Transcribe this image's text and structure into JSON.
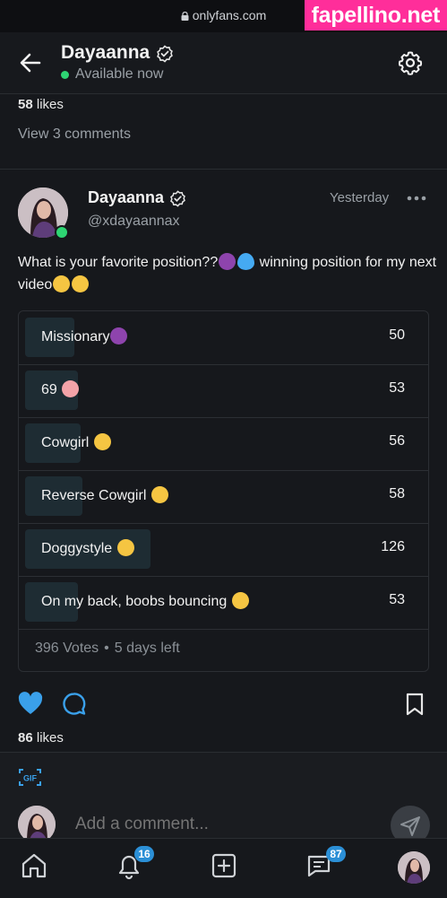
{
  "status_bar": {
    "url": "onlyfans.com",
    "watermark": "fapellino.net"
  },
  "header": {
    "name": "Dayaanna",
    "status": "Available now"
  },
  "previous_post": {
    "likes_count": "58",
    "likes_word": "likes",
    "comments_link": "View 3 comments"
  },
  "post": {
    "author_name": "Dayaanna",
    "handle": "@xdayaannax",
    "time": "Yesterday",
    "text_part1": "What is your favorite position??",
    "text_part2": " winning position for my next video",
    "poll": {
      "options": [
        {
          "label": "Missionary",
          "emoji": "devil",
          "votes": "50",
          "share": 0.126
        },
        {
          "label": "69 ",
          "emoji": "peach",
          "votes": "53",
          "share": 0.134
        },
        {
          "label": "Cowgirl ",
          "emoji": "crazy",
          "votes": "56",
          "share": 0.141
        },
        {
          "label": "Reverse Cowgirl ",
          "emoji": "smirk",
          "votes": "58",
          "share": 0.146
        },
        {
          "label": "Doggystyle ",
          "emoji": "love",
          "votes": "126",
          "share": 0.318
        },
        {
          "label": "On my back, boobs bouncing ",
          "emoji": "wink",
          "votes": "53",
          "share": 0.134
        }
      ],
      "total_votes": "396 Votes",
      "separator": "•",
      "time_left": "5 days left"
    },
    "likes_count": "86",
    "likes_word": "likes"
  },
  "comment": {
    "placeholder": "Add a comment..."
  },
  "bottom_nav": {
    "notifications_badge": "16",
    "messages_badge": "87"
  },
  "colors": {
    "accent": "#2b8fd6",
    "like": "#3aa0ea",
    "online": "#2ed573",
    "background": "#16181c"
  }
}
